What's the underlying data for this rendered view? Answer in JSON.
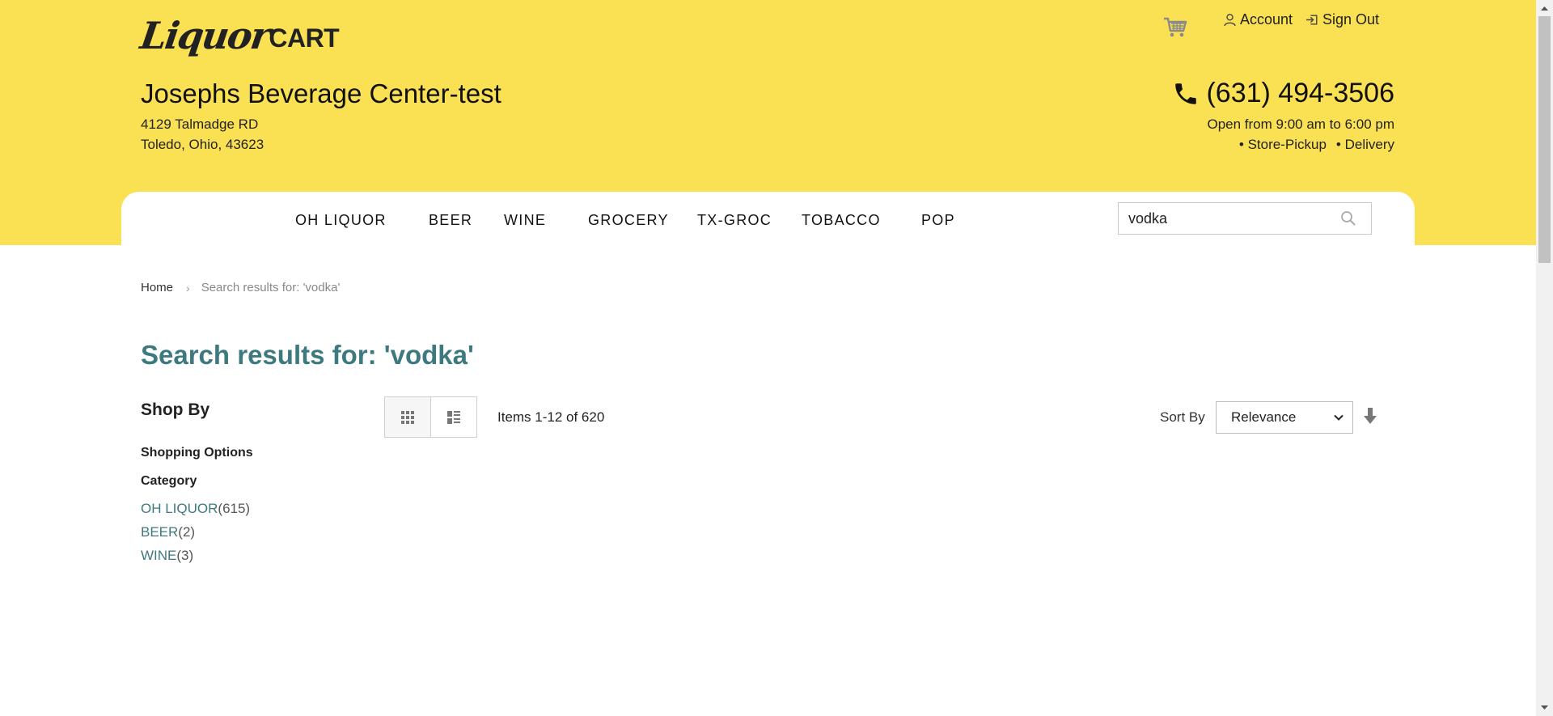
{
  "brand": {
    "logo_script": "Liquor",
    "logo_word": "CART"
  },
  "top_links": {
    "account": "Account",
    "sign_out": "Sign Out"
  },
  "store": {
    "name": "Josephs Beverage Center-test",
    "address_line1": "4129 Talmadge RD",
    "address_line2": "Toledo, Ohio, 43623",
    "phone": "(631) 494-3506",
    "hours": "Open from 9:00 am to 6:00 pm",
    "service_pickup": "• Store-Pickup",
    "service_delivery": "• Delivery"
  },
  "nav": {
    "items": [
      {
        "label": "OH LIQUOR"
      },
      {
        "label": "BEER"
      },
      {
        "label": "WINE"
      },
      {
        "label": "GROCERY"
      },
      {
        "label": "TX-GROC"
      },
      {
        "label": "TOBACCO"
      },
      {
        "label": "POP"
      }
    ]
  },
  "search": {
    "value": "vodka"
  },
  "breadcrumb": {
    "home": "Home",
    "current": "Search results for: 'vodka'"
  },
  "page": {
    "title": "Search results for: 'vodka'"
  },
  "sidebar": {
    "shop_by": "Shop By",
    "shopping_options": "Shopping Options",
    "category_label": "Category",
    "categories": [
      {
        "name": "OH LIQUOR",
        "count": "(615)"
      },
      {
        "name": "BEER",
        "count": "(2)"
      },
      {
        "name": "WINE",
        "count": "(3)"
      }
    ]
  },
  "toolbar": {
    "items_count": "Items 1-12 of 620",
    "sort_label": "Sort By",
    "sort_value": "Relevance"
  },
  "colors": {
    "header": "#fae053",
    "accent": "#3d7a7f"
  },
  "icons": [
    "cart-icon",
    "user-icon",
    "sign-out-icon",
    "phone-icon",
    "search-icon",
    "grid-view-icon",
    "list-view-icon",
    "chevron-down-icon",
    "sort-direction-icon"
  ]
}
